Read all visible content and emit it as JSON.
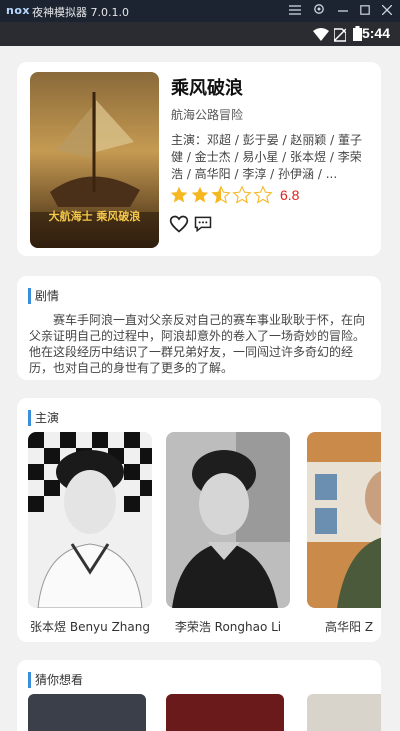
{
  "emulator": {
    "logo": "nox",
    "title": "夜神模拟器 7.0.1.0",
    "controls": [
      "menu-icon",
      "gear-icon",
      "minimize-icon",
      "maximize-icon",
      "close-icon"
    ]
  },
  "status_bar": {
    "time": "5:44"
  },
  "movie": {
    "title": "乘风破浪",
    "genre": "航海公路冒险",
    "cast": "主演：邓超 / 彭于晏 / 赵丽颖 / 董子健 / 金士杰 / 易小星 / 张本煜 / 李荣浩 / 高华阳 / 李淳 / 孙伊涵 / ...",
    "rating": "6.8",
    "stars_filled": 2.5,
    "stars_total": 5,
    "poster_text": "大航海士 乘风破浪"
  },
  "plot": {
    "heading": "剧情",
    "text": "赛车手阿浪一直对父亲反对自己的赛车事业耿耿于怀，在向父亲证明自己的过程中，阿浪却意外的卷入了一场奇妙的冒险。他在这段经历中结识了一群兄弟好友，一同闯过许多奇幻的经历，也对自己的身世有了更多的了解。"
  },
  "cast_section": {
    "heading": "主演",
    "actors": [
      {
        "name": "张本煜 Benyu Zhang"
      },
      {
        "name": "李荣浩 Ronghao Li"
      },
      {
        "name": "高华阳 Z"
      }
    ]
  },
  "recommend": {
    "heading": "猜你想看"
  },
  "colors": {
    "accent": "#3a8fdc",
    "rating": "#e02020",
    "star": "#f5b823"
  }
}
